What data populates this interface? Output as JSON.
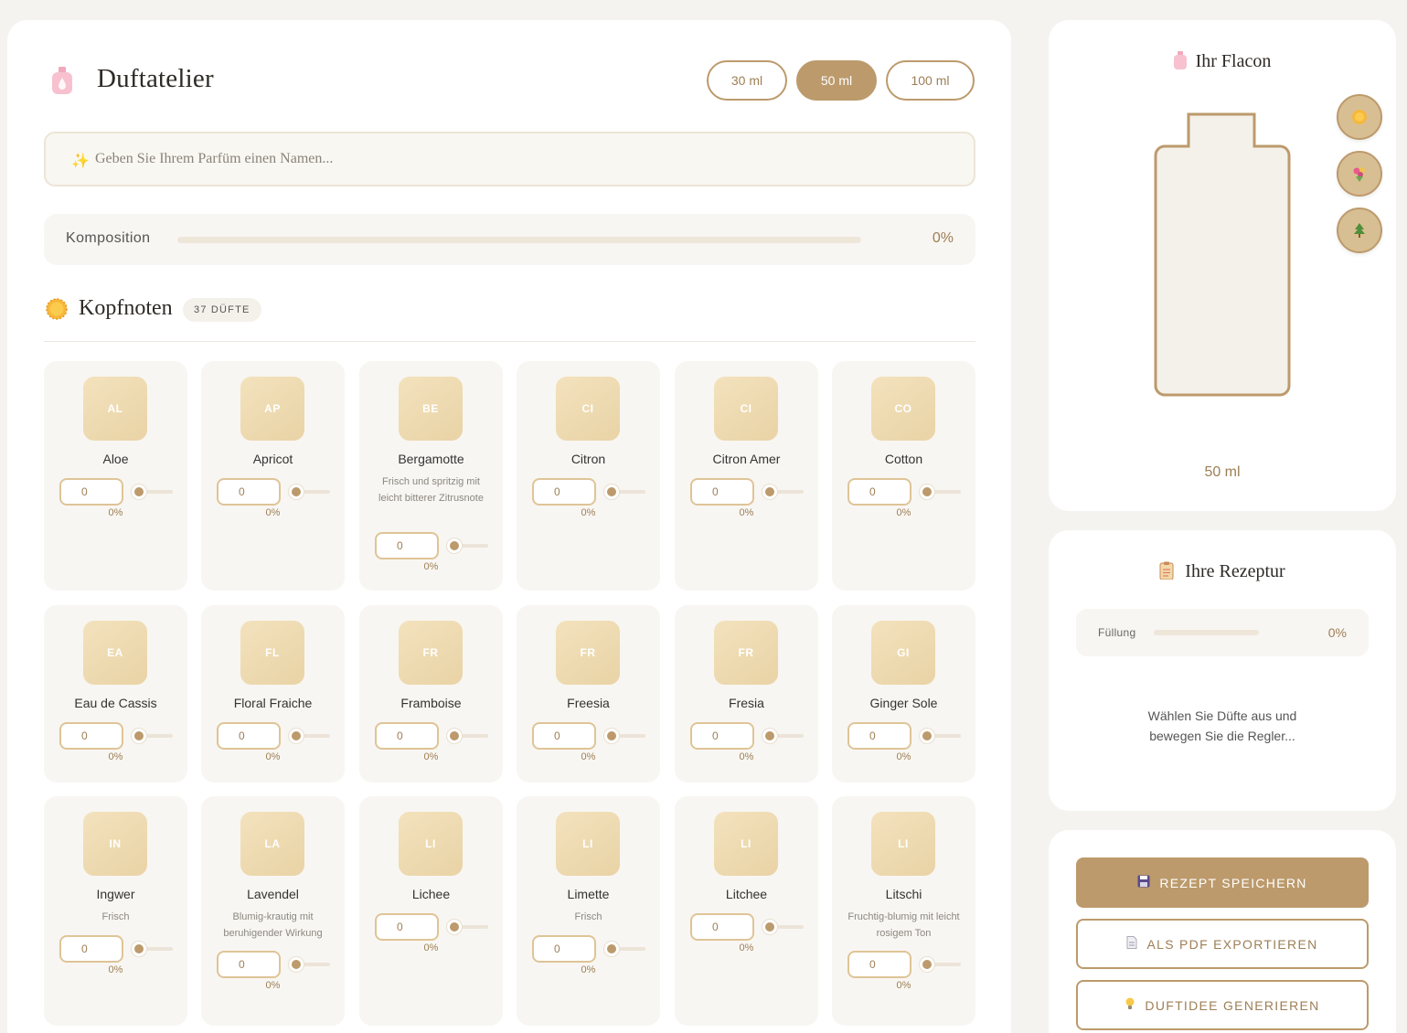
{
  "app": {
    "title": "Duftatelier"
  },
  "sizes": [
    {
      "label": "30 ml",
      "active": false
    },
    {
      "label": "50 ml",
      "active": true
    },
    {
      "label": "100 ml",
      "active": false
    }
  ],
  "name_input": {
    "placeholder": "Geben Sie Ihrem Parfüm einen Namen...",
    "value": ""
  },
  "composition": {
    "label": "Komposition",
    "value_label": "0%",
    "fraction": 0
  },
  "section": {
    "title": "Kopfnoten",
    "count_label": "37 DÜFTE"
  },
  "notes": [
    {
      "abbr": "AL",
      "name": "Aloe",
      "desc": "",
      "value": "0",
      "pct": "0%"
    },
    {
      "abbr": "AP",
      "name": "Apricot",
      "desc": "",
      "value": "0",
      "pct": "0%"
    },
    {
      "abbr": "BE",
      "name": "Bergamotte",
      "desc": "Frisch und spritzig mit leicht bitterer Zitrusnote",
      "value": "0",
      "pct": "0%"
    },
    {
      "abbr": "CI",
      "name": "Citron",
      "desc": "",
      "value": "0",
      "pct": "0%"
    },
    {
      "abbr": "CI",
      "name": "Citron Amer",
      "desc": "",
      "value": "0",
      "pct": "0%"
    },
    {
      "abbr": "CO",
      "name": "Cotton",
      "desc": "",
      "value": "0",
      "pct": "0%"
    },
    {
      "abbr": "EA",
      "name": "Eau de Cassis",
      "desc": "",
      "value": "0",
      "pct": "0%"
    },
    {
      "abbr": "FL",
      "name": "Floral Fraiche",
      "desc": "",
      "value": "0",
      "pct": "0%"
    },
    {
      "abbr": "FR",
      "name": "Framboise",
      "desc": "",
      "value": "0",
      "pct": "0%"
    },
    {
      "abbr": "FR",
      "name": "Freesia",
      "desc": "",
      "value": "0",
      "pct": "0%"
    },
    {
      "abbr": "FR",
      "name": "Fresia",
      "desc": "",
      "value": "0",
      "pct": "0%"
    },
    {
      "abbr": "GI",
      "name": "Ginger Sole",
      "desc": "",
      "value": "0",
      "pct": "0%"
    },
    {
      "abbr": "IN",
      "name": "Ingwer",
      "desc": "Frisch",
      "value": "0",
      "pct": "0%"
    },
    {
      "abbr": "LA",
      "name": "Lavendel",
      "desc": "Blumig-krautig mit beruhigender Wirkung",
      "value": "0",
      "pct": "0%"
    },
    {
      "abbr": "LI",
      "name": "Lichee",
      "desc": "",
      "value": "0",
      "pct": "0%"
    },
    {
      "abbr": "LI",
      "name": "Limette",
      "desc": "Frisch",
      "value": "0",
      "pct": "0%"
    },
    {
      "abbr": "LI",
      "name": "Litchee",
      "desc": "",
      "value": "0",
      "pct": "0%"
    },
    {
      "abbr": "LI",
      "name": "Litschi",
      "desc": "Fruchtig-blumig mit leicht rosigem Ton",
      "value": "0",
      "pct": "0%"
    }
  ],
  "flacon": {
    "title": "Ihr Flacon",
    "size_label": "50 ml",
    "families": [
      "sun-icon",
      "bouquet-icon",
      "tree-icon"
    ]
  },
  "recipe": {
    "title": "Ihre Rezeptur",
    "fill_label": "Füllung",
    "fill_value": "0%",
    "fill_fraction": 0,
    "hint": "Wählen Sie Düfte aus und bewegen Sie die Regler..."
  },
  "actions": {
    "save_label": "REZEPT SPEICHERN",
    "pdf_label": "ALS PDF EXPORTIEREN",
    "idea_label": "DUFTIDEE GENERIEREN"
  },
  "colors": {
    "accent": "#bc9a6c",
    "background": "#f5f3ef",
    "card": "#f8f6f2",
    "badge": "#efdcb4"
  }
}
